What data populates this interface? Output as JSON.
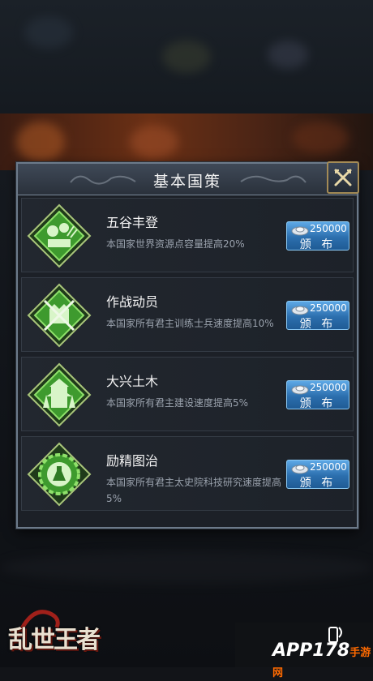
{
  "dialog": {
    "title": "基本国策"
  },
  "policies": [
    {
      "name": "五谷丰登",
      "description": "本国家世界资源点容量提高20%",
      "cost": "250000",
      "action_label": "颁 布",
      "icon": "wheat-icon"
    },
    {
      "name": "作战动员",
      "description": "本国家所有君主训练士兵速度提高10%",
      "cost": "250000",
      "action_label": "颁 布",
      "icon": "crossed-swords-castle-icon"
    },
    {
      "name": "大兴土木",
      "description": "本国家所有君主建设速度提高5%",
      "cost": "250000",
      "action_label": "颁 布",
      "icon": "pagoda-icon"
    },
    {
      "name": "励精图治",
      "description": "本国家所有君主太史院科技研究速度提高5%",
      "cost": "250000",
      "action_label": "颁 布",
      "icon": "flask-gear-icon"
    }
  ],
  "currency_icon": "silver-ingot-icon",
  "game_logo": "乱世王者",
  "watermark": {
    "brand": "APP178",
    "suffix": "手游网"
  },
  "colors": {
    "button": "#2c6fae",
    "emblem_green": "#4dbb3a",
    "frame": "#6c7a8a"
  }
}
